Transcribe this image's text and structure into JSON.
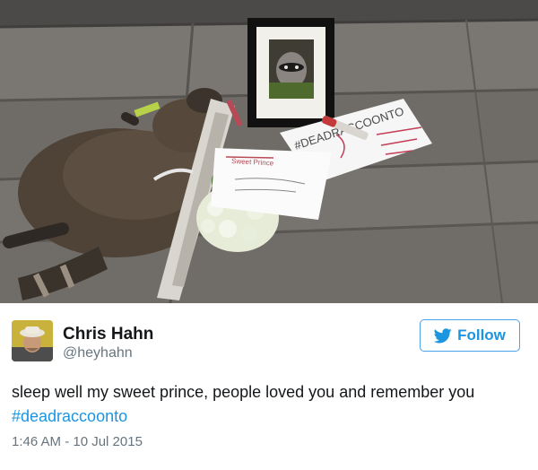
{
  "photo": {
    "sign_text": "#DEADRACCOONTO",
    "note_text": "Sweet Prince"
  },
  "tweet": {
    "author_name": "Chris Hahn",
    "author_handle": "@heyhahn",
    "follow_label": "Follow",
    "text_prefix": "sleep well my sweet prince, people loved you and remember you ",
    "hashtag": "#deadraccoonto",
    "timestamp": "1:46 AM - 10 Jul 2015"
  },
  "colors": {
    "accent": "#1b95e0",
    "text": "#14171a",
    "muted": "#66757f"
  },
  "icons": {
    "follow": "twitter-bird-icon"
  }
}
